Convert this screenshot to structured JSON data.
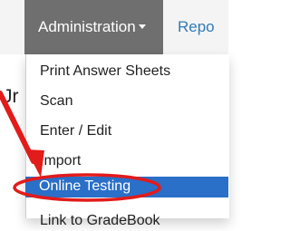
{
  "navbar": {
    "administration_label": "Administration",
    "reports_label": "Repo"
  },
  "background": {
    "partial_text": "Jr"
  },
  "menu": {
    "items": [
      {
        "label": "Print Answer Sheets"
      },
      {
        "label": "Scan"
      },
      {
        "label": "Enter / Edit"
      },
      {
        "label": "Import"
      },
      {
        "label": "Online Testing",
        "active": true
      },
      {
        "label": "Link to GradeBook"
      }
    ]
  },
  "colors": {
    "active_tab": "#6f6f6f",
    "highlight": "#2a6fc8",
    "annotation": "#e21b1b",
    "link": "#337ab7"
  }
}
